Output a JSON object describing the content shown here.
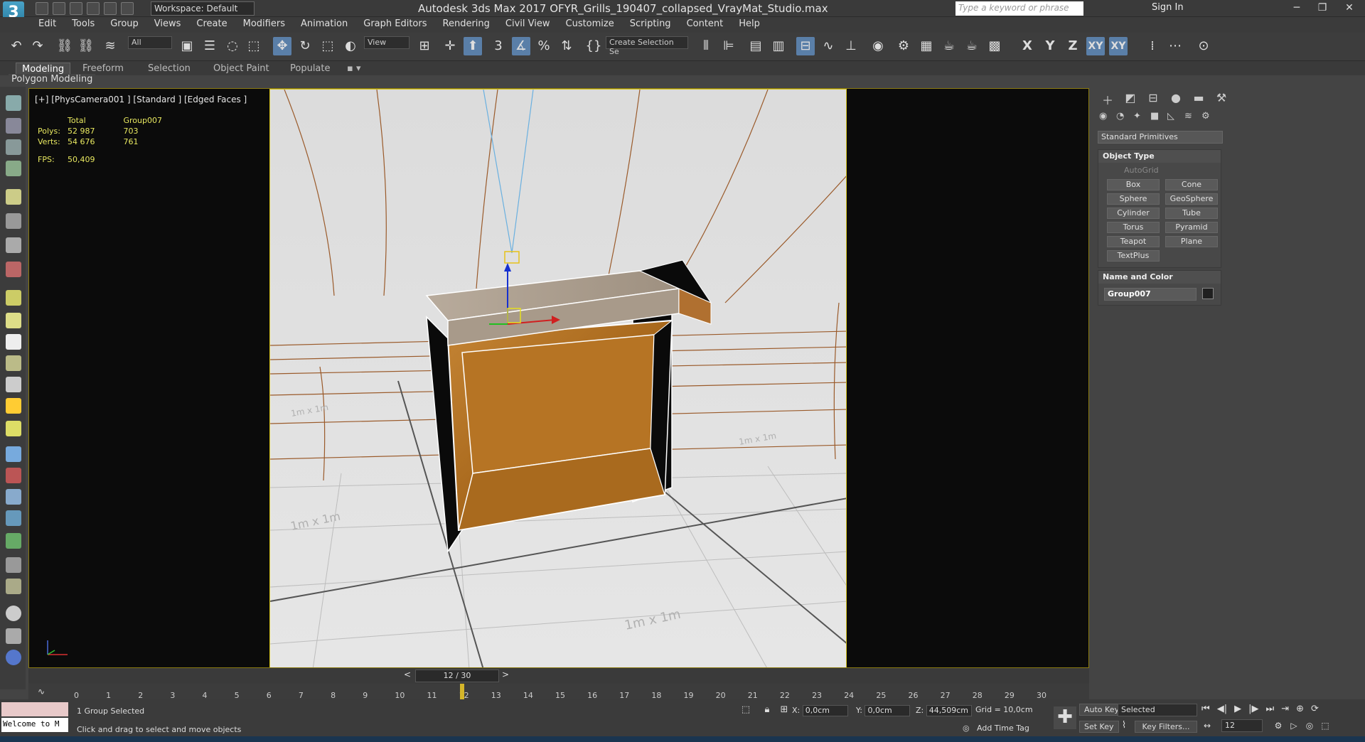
{
  "app": {
    "window_title": "Autodesk 3ds Max 2017    OFYR_Grills_190407_collapsed_VrayMat_Studio.max",
    "workspace_label": "Workspace: Default",
    "search_placeholder": "Type a keyword or phrase",
    "sign_in": "Sign In",
    "logo_char": "3"
  },
  "menu": [
    "Edit",
    "Tools",
    "Group",
    "Views",
    "Create",
    "Modifiers",
    "Animation",
    "Graph Editors",
    "Rendering",
    "Civil View",
    "Customize",
    "Scripting",
    "Content",
    "Help"
  ],
  "toolbar": {
    "selection_filter": "All",
    "ref_coord": "View",
    "selection_set": "Create Selection Se",
    "axis_labels": [
      "X",
      "Y",
      "Z",
      "XY",
      "XY"
    ]
  },
  "ribbon": {
    "tabs": [
      "Modeling",
      "Freeform",
      "Selection",
      "Object Paint",
      "Populate"
    ],
    "active_tab": "Modeling",
    "sub_label": "Polygon Modeling"
  },
  "viewport": {
    "label": "[+] [PhysCamera001 ] [Standard ] [Edged Faces ]",
    "stats": {
      "col_total": "Total",
      "col_group": "Group007",
      "polys_label": "Polys:",
      "polys_total": "52 987",
      "polys_group": "703",
      "verts_label": "Verts:",
      "verts_total": "54 676",
      "verts_group": "761",
      "fps_label": "FPS:",
      "fps_value": "50,409"
    },
    "grid_labels": [
      "1m x 1m",
      "1m x 1m",
      "1m x 1m",
      "1m x 1m"
    ]
  },
  "command_panel": {
    "category": "Standard Primitives",
    "object_type_title": "Object Type",
    "autogrid_label": "AutoGrid",
    "primitives": [
      "Box",
      "Cone",
      "Sphere",
      "GeoSphere",
      "Cylinder",
      "Tube",
      "Torus",
      "Pyramid",
      "Teapot",
      "Plane",
      "TextPlus"
    ],
    "name_color_title": "Name and Color",
    "object_name": "Group007",
    "object_color": "#202020"
  },
  "timeline": {
    "frame_counter": "12 / 30",
    "current_frame": 12,
    "total_frames": 30,
    "ticks": [
      "0",
      "1",
      "2",
      "3",
      "4",
      "5",
      "6",
      "7",
      "8",
      "9",
      "10",
      "11",
      "12",
      "13",
      "14",
      "15",
      "16",
      "17",
      "18",
      "19",
      "20",
      "21",
      "22",
      "23",
      "24",
      "25",
      "26",
      "27",
      "28",
      "29",
      "30"
    ]
  },
  "status": {
    "maxscript_text": "Welcome to M",
    "selection_info": "1 Group Selected",
    "prompt": "Click and drag to select and move objects",
    "x_label": "X:",
    "x_value": "0,0cm",
    "y_label": "Y:",
    "y_value": "0,0cm",
    "z_label": "Z:",
    "z_value": "44,509cm",
    "grid": "Grid = 10,0cm",
    "add_time_tag": "Add Time Tag",
    "auto_key": "Auto Key",
    "set_key": "Set Key",
    "key_mode": "Selected",
    "key_filters": "Key Filters...",
    "frame_field": "12"
  },
  "colors": {
    "accent": "#5a7fa8",
    "safe_frame": "#d6c41f",
    "stats_text": "#e8e860",
    "wood": "#b7782a"
  }
}
